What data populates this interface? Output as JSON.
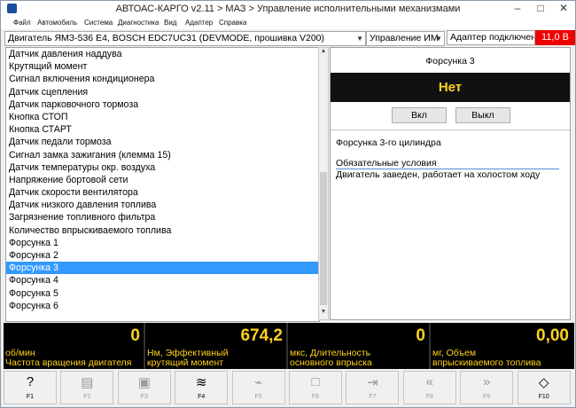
{
  "window": {
    "title": "АВТОАС-КАРГО v2.11 > МАЗ > Управление исполнительными механизмами"
  },
  "menu": [
    "Файл",
    "Автомобиль",
    "Система",
    "Диагностика",
    "Вид",
    "Адаптер",
    "Справка"
  ],
  "selectors": {
    "engine": "Двигатель ЯМЗ-536 Е4, BOSCH EDC7UC31 (DEVMODE, прошивка V200)",
    "mode": "Управление ИМ",
    "adapter_status": "Адаптер подключен",
    "voltage": "11,0 В"
  },
  "list": {
    "items": [
      "Датчик давления наддува",
      "Крутящий момент",
      "Сигнал включения кондиционера",
      "Датчик сцепления",
      "Датчик парковочного тормоза",
      "Кнопка СТОП",
      "Кнопка СТАРТ",
      "Датчик педали тормоза",
      "Сигнал замка зажигания (клемма 15)",
      "Датчик температуры окр. воздуха",
      "Напряжение бортовой сети",
      "Датчик скорости вентилятора",
      "Датчик низкого давления топлива",
      "Загрязнение топливного фильтра",
      "Количество впрыскиваемого топлива",
      "Форсунка 1",
      "Форсунка 2",
      "Форсунка 3",
      "Форсунка 4",
      "Форсунка 5",
      "Форсунка 6"
    ],
    "selected": "Форсунка 3"
  },
  "panel": {
    "title": "Форсунка 3",
    "state": "Нет",
    "on_label": "Вкл",
    "off_label": "Выкл",
    "description": "Форсунка 3-го цилиндра",
    "conditions_header": "Обязательные условия",
    "conditions": "Двигатель заведен, работает на холостом ходу"
  },
  "gauges": [
    {
      "value": "0",
      "unit_line1": "об/мин",
      "unit_line2": "Частота вращения двигателя"
    },
    {
      "value": "674,2",
      "unit_line1": "Нм, Эффективный",
      "unit_line2": "крутящий момент"
    },
    {
      "value": "0",
      "unit_line1": "мкс, Длительность",
      "unit_line2": "основного впрыска"
    },
    {
      "value": "0,00",
      "unit_line1": "мг, Объем",
      "unit_line2": "впрыскиваемого топлива"
    }
  ],
  "fkeys": [
    {
      "label": "F1",
      "icon": "help-icon",
      "glyph": "?",
      "active": true
    },
    {
      "label": "F2",
      "icon": "report-icon",
      "glyph": "▤",
      "active": false
    },
    {
      "label": "F3",
      "icon": "save-icon",
      "glyph": "▣",
      "active": false
    },
    {
      "label": "F4",
      "icon": "graph-icon",
      "glyph": "≋",
      "active": true
    },
    {
      "label": "F5",
      "icon": "broom-icon",
      "glyph": "⌁",
      "active": false
    },
    {
      "label": "F6",
      "icon": "stop-icon",
      "glyph": "□",
      "active": false
    },
    {
      "label": "F7",
      "icon": "export-icon",
      "glyph": "⇥",
      "active": false
    },
    {
      "label": "F8",
      "icon": "rewind-icon",
      "glyph": "«",
      "active": false
    },
    {
      "label": "F9",
      "icon": "forward-icon",
      "glyph": "»",
      "active": false
    },
    {
      "label": "F10",
      "icon": "exit-icon",
      "glyph": "◇",
      "active": true
    }
  ],
  "colors": {
    "accent_selection": "#3399ff",
    "gauge_value": "#ffd21e",
    "voltage_bg": "#ee0000"
  }
}
